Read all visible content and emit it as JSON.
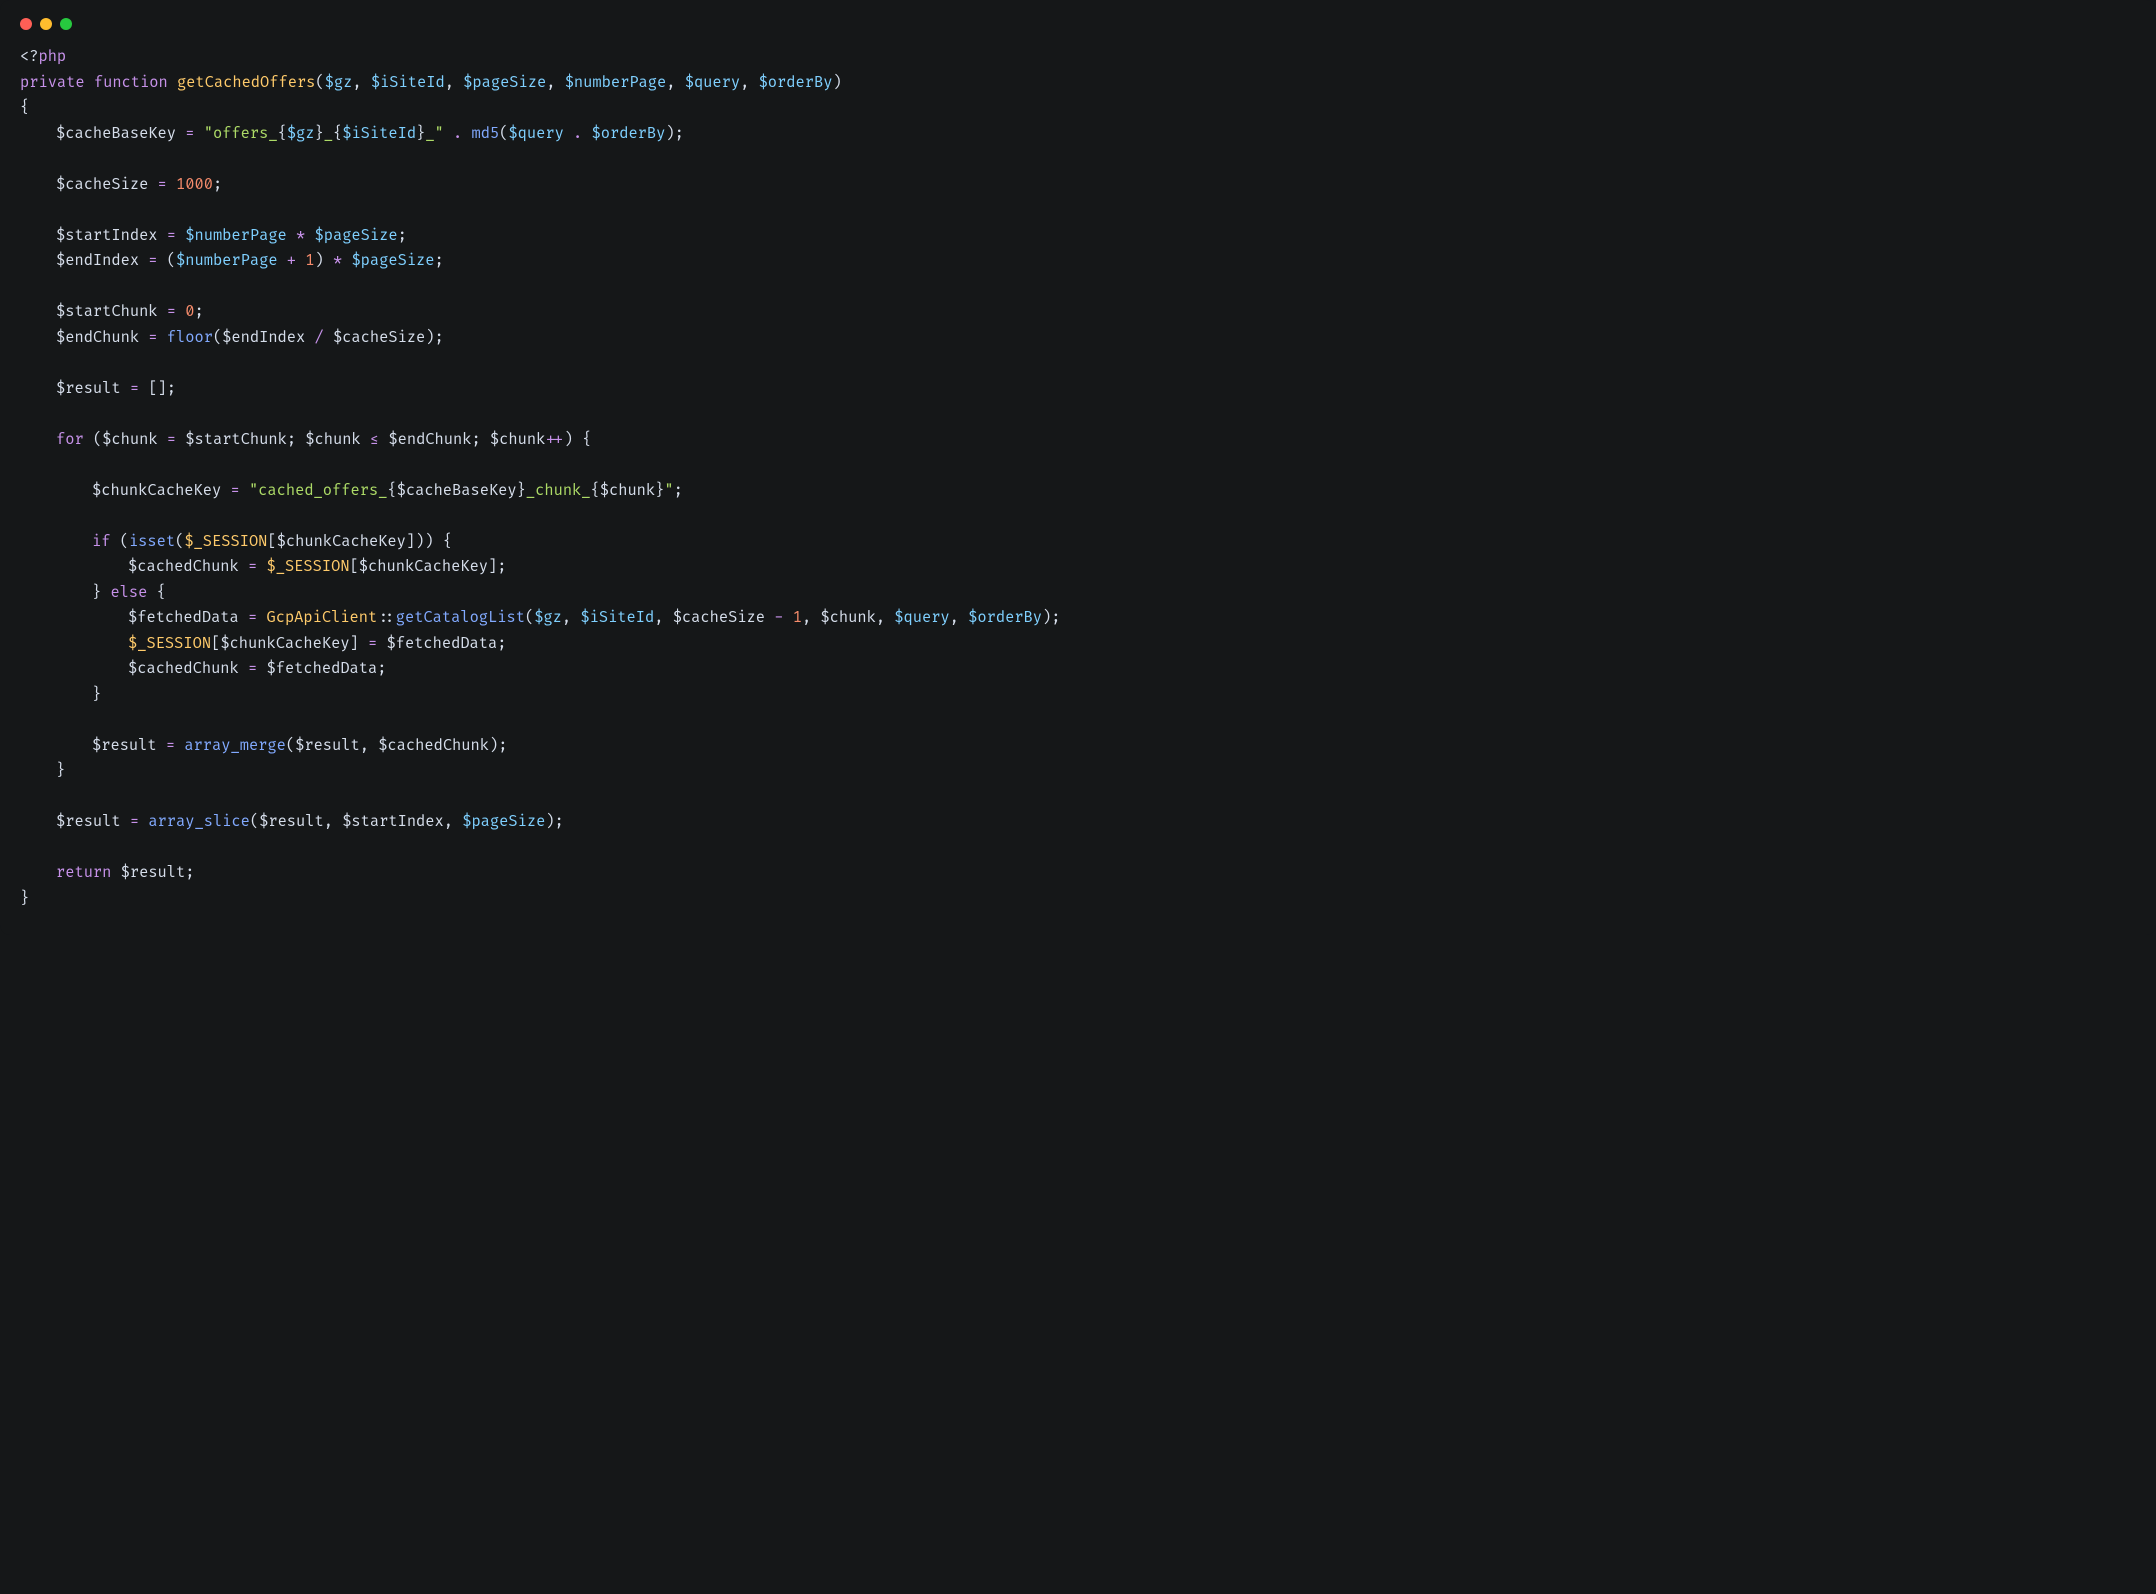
{
  "colors": {
    "background": "#151718",
    "keyword": "#c792ea",
    "function": "#82aaff",
    "funcname": "#ffcb6b",
    "string": "#addb67",
    "number": "#f78c6c",
    "default": "#d6deeb"
  },
  "traffic_lights": [
    "close",
    "minimize",
    "zoom"
  ],
  "language": "php",
  "code": {
    "open_tag": "<?php",
    "kw_private": "private",
    "kw_function": "function",
    "fn_name": "getCachedOffers",
    "params": [
      "$gz",
      "$iSiteId",
      "$pageSize",
      "$numberPage",
      "$query",
      "$orderBy"
    ],
    "brace_open": "{",
    "brace_close": "}",
    "var_cacheBaseKey": "$cacheBaseKey",
    "assign": " = ",
    "str_offers_open": "\"offers_",
    "interp_open": "{",
    "interp_close": "}",
    "str_sep": "_",
    "str_offers_close": "_\"",
    "concat": " . ",
    "fn_md5": "md5",
    "paren_open": "(",
    "paren_close": ")",
    "semi": ";",
    "var_cacheSize": "$cacheSize",
    "num_1000": "1000",
    "var_startIndex": "$startIndex",
    "var_numberPage": "$numberPage",
    "mul": " * ",
    "var_pageSize": "$pageSize",
    "var_endIndex": "$endIndex",
    "plus1": " + ",
    "num_1": "1",
    "var_startChunk": "$startChunk",
    "num_0": "0",
    "var_endChunk": "$endChunk",
    "fn_floor": "floor",
    "div": " / ",
    "var_result": "$result",
    "empty_arr": "[]",
    "kw_for": "for",
    "var_chunk": "$chunk",
    "lte": " ≤ ",
    "inc": "++",
    "var_chunkCacheKey": "$chunkCacheKey",
    "str_cached_prefix": "\"cached_offers_",
    "str_chunk_mid": "_chunk_",
    "str_close_quote": "\"",
    "kw_if": "if",
    "fn_isset": "isset",
    "var_session": "$_SESSION",
    "bracket_open": "[",
    "bracket_close": "]",
    "var_cachedChunk": "$cachedChunk",
    "kw_else": "else",
    "var_fetchedData": "$fetchedData",
    "cls_GcpApiClient": "GcpApiClient",
    "scope": "::",
    "fn_getCatalogList": "getCatalogList",
    "minus": " - ",
    "comma_sp": ", ",
    "fn_array_merge": "array_merge",
    "fn_array_slice": "array_slice",
    "kw_return": "return"
  }
}
